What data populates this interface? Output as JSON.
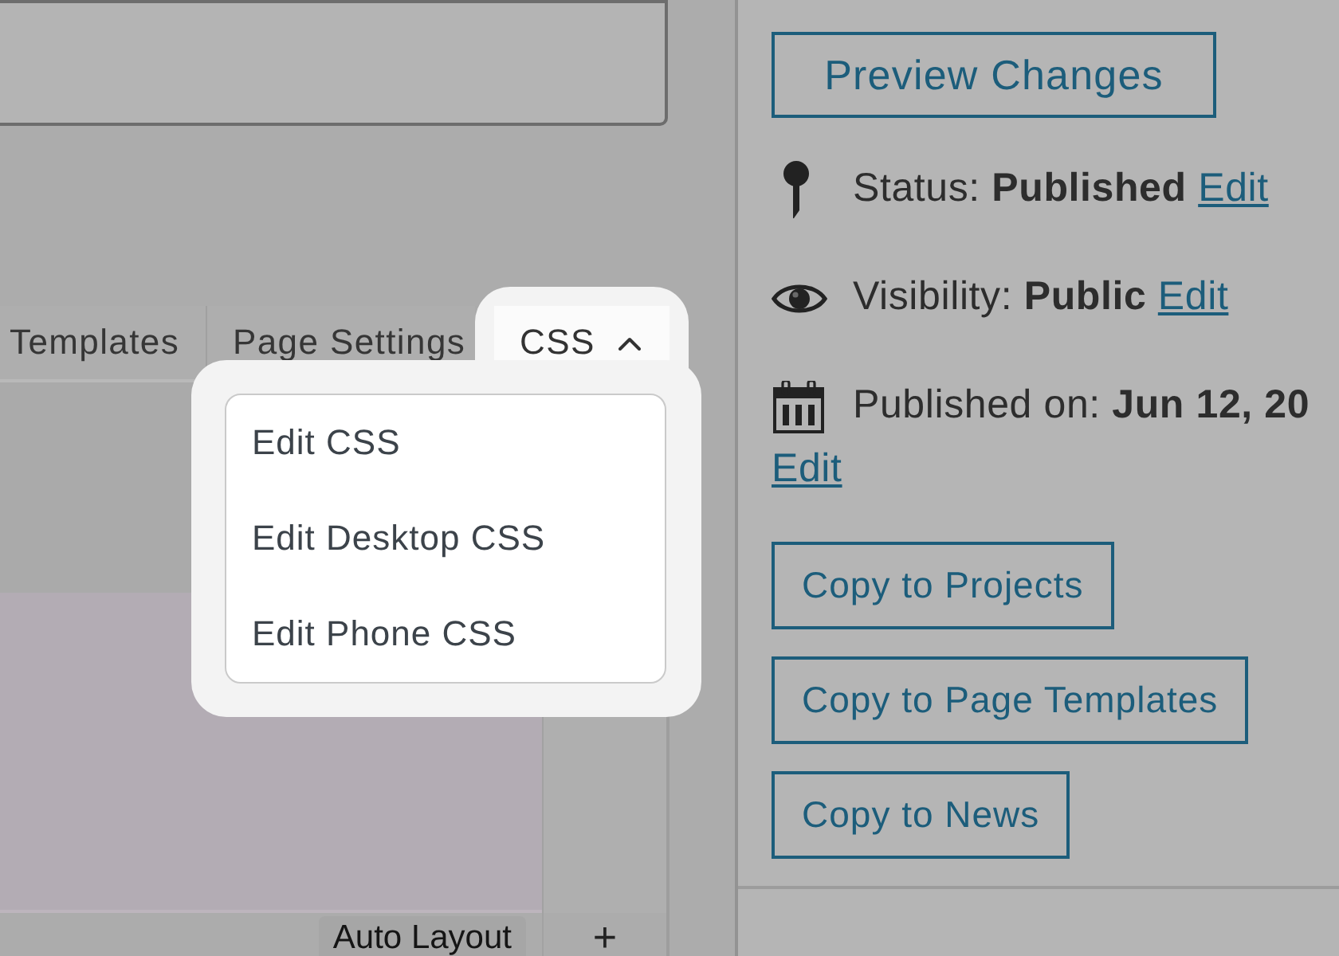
{
  "tabs": [
    {
      "label": "Templates",
      "kind": "plain",
      "selected": false
    },
    {
      "label": "Page Settings",
      "kind": "plain",
      "selected": false
    },
    {
      "label": "CSS",
      "kind": "dropdown",
      "selected": true
    }
  ],
  "css_menu": {
    "expanded": true,
    "items": [
      {
        "label": "Edit CSS"
      },
      {
        "label": "Edit Desktop CSS"
      },
      {
        "label": "Edit Phone CSS"
      }
    ]
  },
  "canvas": {
    "layout_badge": "Auto Layout",
    "add_button": "+"
  },
  "sidebar": {
    "preview_button": "Preview Changes",
    "meta": [
      {
        "kind": "status",
        "text": "Status: **Published**",
        "link": "Edit"
      },
      {
        "kind": "visibility",
        "text": "Visibility: **Public**",
        "link": "Edit"
      },
      {
        "kind": "date",
        "text": "Published on: **Jun 12, 20**",
        "link": "Edit"
      }
    ],
    "copy_buttons": [
      "Copy to Projects",
      "Copy to Page Templates",
      "Copy to News"
    ]
  }
}
